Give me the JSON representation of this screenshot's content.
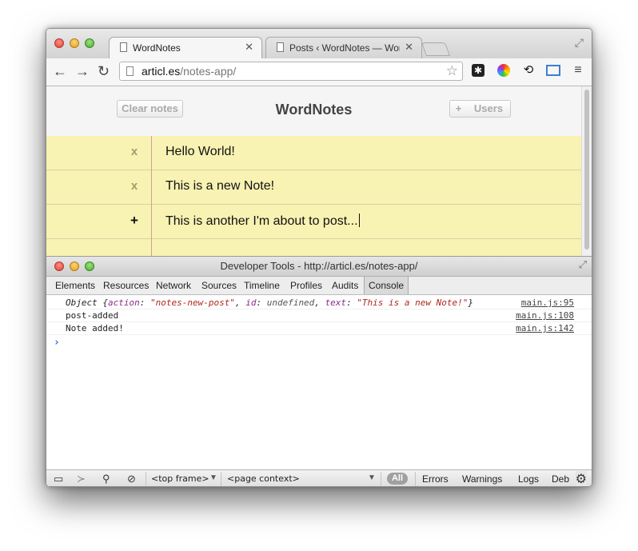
{
  "browser": {
    "tabs": [
      {
        "title": "WordNotes",
        "active": true
      },
      {
        "title": "Posts ‹ WordNotes — WordPress",
        "active": false
      }
    ],
    "url_host": "articl.es",
    "url_path": "/notes-app/"
  },
  "app": {
    "clear_label": "Clear notes",
    "title": "WordNotes",
    "add_label": "+",
    "users_label": "Users",
    "notes": [
      {
        "marker": "x",
        "text": "Hello World!"
      },
      {
        "marker": "x",
        "text": "This is a new Note!"
      },
      {
        "marker": "+",
        "text": "This is another I'm about to post..."
      },
      {
        "marker": "",
        "text": ""
      }
    ]
  },
  "devtools": {
    "title": "Developer Tools - http://articl.es/notes-app/",
    "tabs": [
      "Elements",
      "Resources",
      "Network",
      "Sources",
      "Timeline",
      "Profiles",
      "Audits",
      "Console"
    ],
    "active_tab": "Console",
    "console": {
      "log1": {
        "prefix": "Object {",
        "k1": "action",
        "v1": "\"notes-new-post\"",
        "sep1": ", ",
        "k2": "id",
        "v2": "undefined",
        "sep2": ", ",
        "k3": "text",
        "v3": "\"This is a new Note!\"",
        "suffix": "}",
        "source": "main.js:95"
      },
      "log2": {
        "text": "post-added",
        "source": "main.js:108"
      },
      "log3": {
        "text": "Note added!",
        "source": "main.js:142"
      },
      "prompt": "›"
    },
    "status": {
      "frame": "<top frame>",
      "context": "<page context>",
      "all": "All",
      "errors": "Errors",
      "warnings": "Warnings",
      "logs": "Logs",
      "debug": "Deb"
    }
  }
}
